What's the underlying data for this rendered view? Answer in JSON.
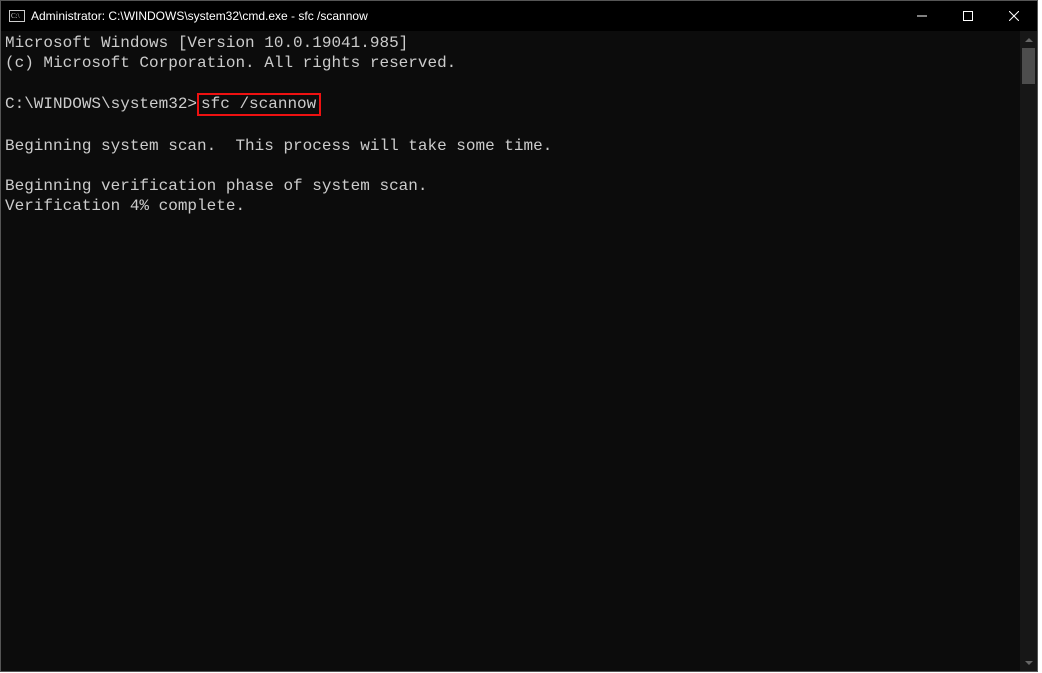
{
  "window": {
    "title": "Administrator: C:\\WINDOWS\\system32\\cmd.exe - sfc  /scannow"
  },
  "terminal": {
    "line_version": "Microsoft Windows [Version 10.0.19041.985]",
    "line_copyright": "(c) Microsoft Corporation. All rights reserved.",
    "prompt": "C:\\WINDOWS\\system32>",
    "command": "sfc /scannow",
    "line_begin_scan": "Beginning system scan.  This process will take some time.",
    "line_begin_verify": "Beginning verification phase of system scan.",
    "verification_percent": 4,
    "line_verification": "Verification 4% complete."
  },
  "highlight_color": "#e11"
}
